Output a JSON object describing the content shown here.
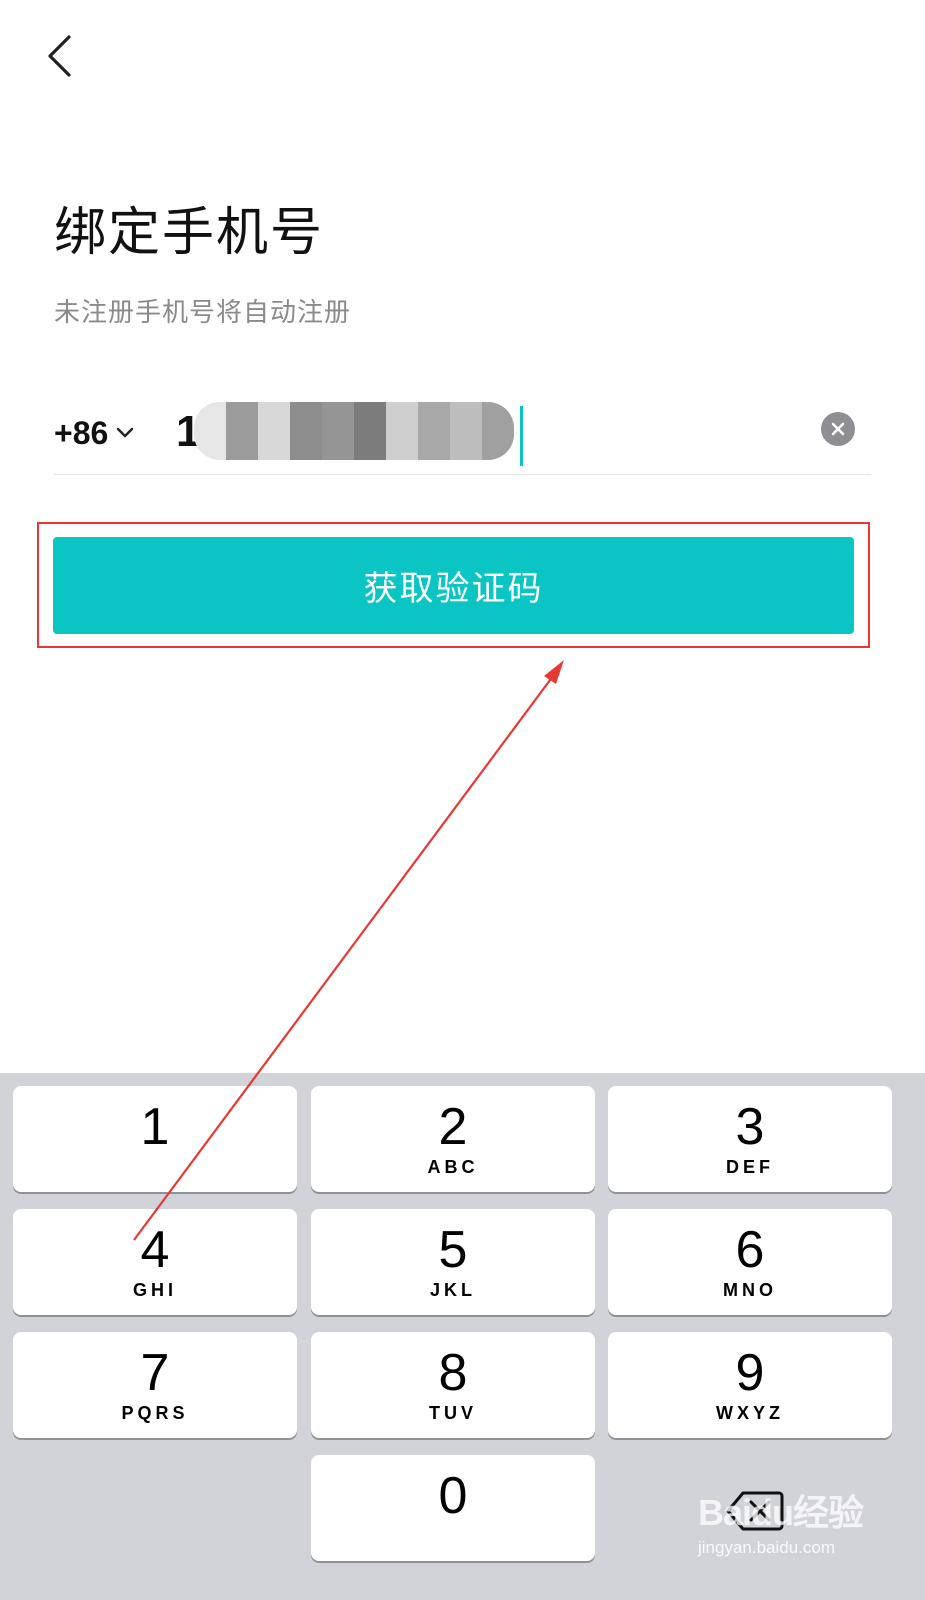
{
  "header": {
    "back_icon": "chevron-left-icon"
  },
  "title": "绑定手机号",
  "subtitle": "未注册手机号将自动注册",
  "phone": {
    "country_code": "+86",
    "first_digit": "1",
    "clear_icon": "close-circle-icon"
  },
  "primary_button": {
    "label": "获取验证码",
    "color": "#0bc5c5"
  },
  "annotation": {
    "box_color": "#e53935"
  },
  "keyboard": {
    "keys": [
      {
        "num": "1",
        "letters": ""
      },
      {
        "num": "2",
        "letters": "ABC"
      },
      {
        "num": "3",
        "letters": "DEF"
      },
      {
        "num": "4",
        "letters": "GHI"
      },
      {
        "num": "5",
        "letters": "JKL"
      },
      {
        "num": "6",
        "letters": "MNO"
      },
      {
        "num": "7",
        "letters": "PQRS"
      },
      {
        "num": "8",
        "letters": "TUV"
      },
      {
        "num": "9",
        "letters": "WXYZ"
      },
      {
        "num": "0",
        "letters": ""
      }
    ],
    "delete_icon": "backspace-icon"
  },
  "watermark": {
    "brand": "Baidu经验",
    "url": "jingyan.baidu.com"
  }
}
